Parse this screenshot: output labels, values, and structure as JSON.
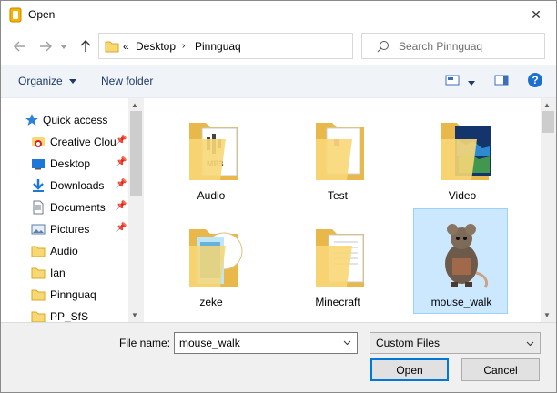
{
  "window": {
    "title": "Open",
    "close_label": "✕"
  },
  "nav": {
    "breadcrumb_prefix": "«",
    "breadcrumbs": [
      "Desktop",
      "Pinnguaq"
    ],
    "search_placeholder": "Search Pinnguaq"
  },
  "toolbar": {
    "organize_label": "Organize",
    "new_folder_label": "New folder"
  },
  "sidebar": {
    "items": [
      {
        "label": "Quick access",
        "icon": "star-icon",
        "pinned": false
      },
      {
        "label": "Creative Clou",
        "icon": "creative-cloud-icon",
        "pinned": true
      },
      {
        "label": "Desktop",
        "icon": "desktop-icon",
        "pinned": true
      },
      {
        "label": "Downloads",
        "icon": "download-icon",
        "pinned": true
      },
      {
        "label": "Documents",
        "icon": "documents-icon",
        "pinned": true
      },
      {
        "label": "Pictures",
        "icon": "pictures-icon",
        "pinned": true
      },
      {
        "label": "Audio",
        "icon": "folder-icon",
        "pinned": false
      },
      {
        "label": "Ian",
        "icon": "folder-icon",
        "pinned": false
      },
      {
        "label": "Pinnguaq",
        "icon": "folder-icon",
        "pinned": false
      },
      {
        "label": "PP_SfS",
        "icon": "folder-icon",
        "pinned": false
      }
    ]
  },
  "files": [
    {
      "label": "Audio",
      "icon": "audio-folder-icon",
      "selected": false
    },
    {
      "label": "Test",
      "icon": "folder-icon",
      "selected": false
    },
    {
      "label": "Video",
      "icon": "video-folder-icon",
      "selected": false
    },
    {
      "label": "zeke",
      "icon": "image-folder-icon",
      "selected": false
    },
    {
      "label": "Minecraft",
      "icon": "folder-icon",
      "selected": false
    },
    {
      "label": "mouse_walk",
      "icon": "mouse-sprite-icon",
      "selected": true
    }
  ],
  "bottom": {
    "file_name_label": "File name:",
    "file_name_value": "mouse_walk",
    "filter_value": "Custom Files",
    "open_label": "Open",
    "cancel_label": "Cancel"
  },
  "colors": {
    "accent": "#0078d7",
    "selection": "#cce8ff",
    "folder": "#f8d775",
    "link": "#1e3a66"
  }
}
